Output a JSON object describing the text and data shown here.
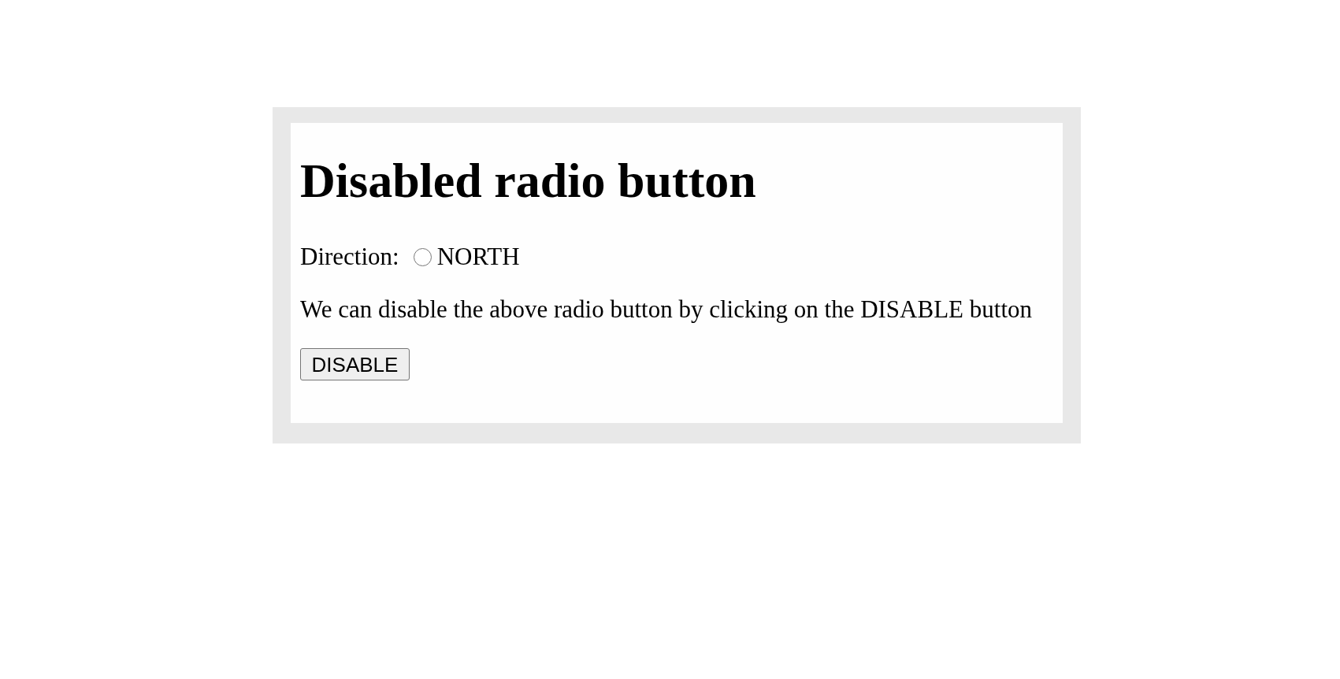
{
  "heading": "Disabled radio button",
  "field": {
    "label": "Direction:",
    "radios": [
      {
        "label": "NORTH",
        "selected": false,
        "disabled": false
      }
    ]
  },
  "paragraph": "We can disable the above radio button by clicking on the DISABLE button",
  "button": {
    "label": "DISABLE"
  }
}
